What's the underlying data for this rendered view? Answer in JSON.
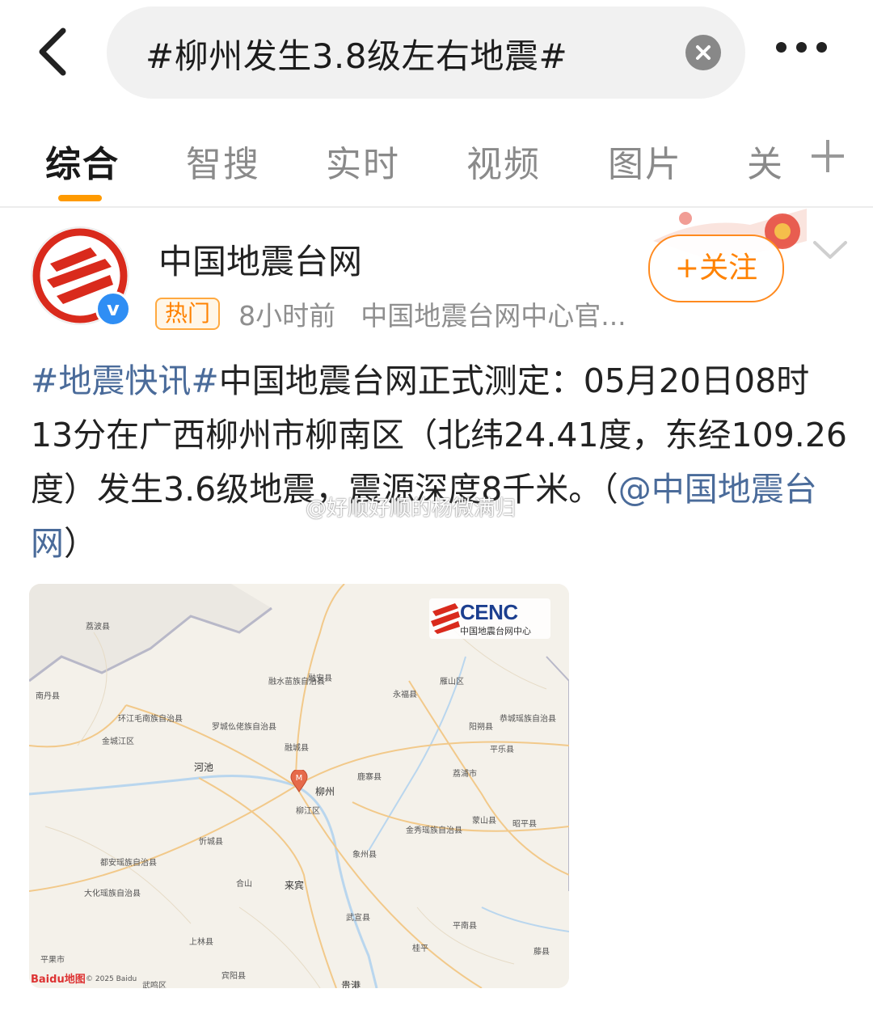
{
  "search": {
    "query": "#柳州发生3.8级左右地震#"
  },
  "tabs": [
    {
      "label": "综合",
      "active": true
    },
    {
      "label": "智搜"
    },
    {
      "label": "实时"
    },
    {
      "label": "视频"
    },
    {
      "label": "图片"
    },
    {
      "label": "关"
    }
  ],
  "post": {
    "author": "中国地震台网",
    "badge": "热门",
    "time": "8小时前",
    "source": "中国地震台网中心官...",
    "follow_label": "+关注",
    "topic": "#地震快讯#",
    "body_text": "中国地震台网正式测定：05月20日08时13分在广西柳州市柳南区（北纬24.41度，东经109.26度）发生3.6级地震，震源深度8千米。（",
    "mention": "@中国地震台网",
    "body_end": "）",
    "watermark": "@好顺好顺的杨微满归"
  },
  "map": {
    "logo_text": "CENC",
    "logo_sub": "中国地震台网中心",
    "baidu": "Baidu地图",
    "copyright": "© 2025 Baidu",
    "marker": "M",
    "labels": [
      "荔波县",
      "融安县",
      "融水苗族自治县",
      "永福县",
      "雁山区",
      "南丹县",
      "环江毛南族自治县",
      "罗城仫佬族自治县",
      "阳朔县",
      "恭城瑶族自治县",
      "金城江区",
      "融城县",
      "平乐县",
      "河池",
      "鹿寨县",
      "荔浦市",
      "柳州",
      "柳江区",
      "蒙山县",
      "金秀瑶族自治县",
      "昭平县",
      "忻城县",
      "象州县",
      "都安瑶族自治县",
      "合山",
      "来宾",
      "大化瑶族自治县",
      "武宣县",
      "平南县",
      "上林县",
      "桂平",
      "藤县",
      "平果市",
      "宾阳县",
      "武鸣区",
      "贵港"
    ]
  },
  "colors": {
    "accent": "#ff8200",
    "link": "#4a6b9a",
    "verified": "#2f8ef4"
  }
}
